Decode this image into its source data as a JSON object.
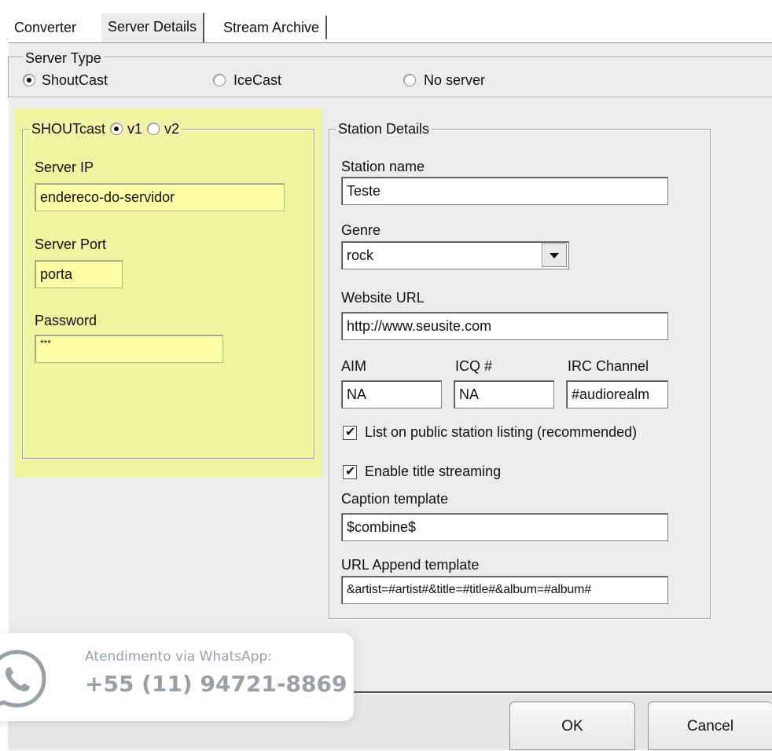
{
  "tabs": [
    {
      "label": "Converter"
    },
    {
      "label": "Server Details"
    },
    {
      "label": "Stream Archive"
    }
  ],
  "server_type": {
    "legend": "Server Type",
    "options": [
      {
        "label": "ShoutCast",
        "selected": true
      },
      {
        "label": "IceCast",
        "selected": false
      },
      {
        "label": "No server",
        "selected": false
      }
    ]
  },
  "shoutcast": {
    "legend": "SHOUTcast",
    "v1_label": "v1",
    "v2_label": "v2",
    "version_selected": "v1",
    "server_ip_label": "Server IP",
    "server_ip_value": "endereco-do-servidor",
    "server_port_label": "Server Port",
    "server_port_value": "porta",
    "password_label": "Password",
    "password_value": "***"
  },
  "station": {
    "legend": "Station Details",
    "name_label": "Station name",
    "name_value": "Teste",
    "genre_label": "Genre",
    "genre_value": "rock",
    "website_label": "Website URL",
    "website_value": "http://www.seusite.com",
    "aim_label": "AIM",
    "aim_value": "NA",
    "icq_label": "ICQ #",
    "icq_value": "NA",
    "irc_label": "IRC Channel",
    "irc_value": "#audiorealm",
    "list_public_label": "List on public station listing (recommended)",
    "list_public_checked": true,
    "title_streaming_label": "Enable title streaming",
    "title_streaming_checked": true,
    "caption_label": "Caption template",
    "caption_value": "$combine$",
    "url_append_label": "URL Append template",
    "url_append_value": "&artist=#artist#&title=#title#&album=#album#"
  },
  "buttons": {
    "ok": "OK",
    "cancel": "Cancel"
  },
  "whatsapp": {
    "subtitle": "Atendimento via WhatsApp:",
    "number": "+55 (11) 94721-8869",
    "icon": "whatsapp-icon"
  },
  "colors": {
    "panel": "#ececec",
    "highlight": "#f2f878",
    "field_yellow": "#ffffa8"
  }
}
